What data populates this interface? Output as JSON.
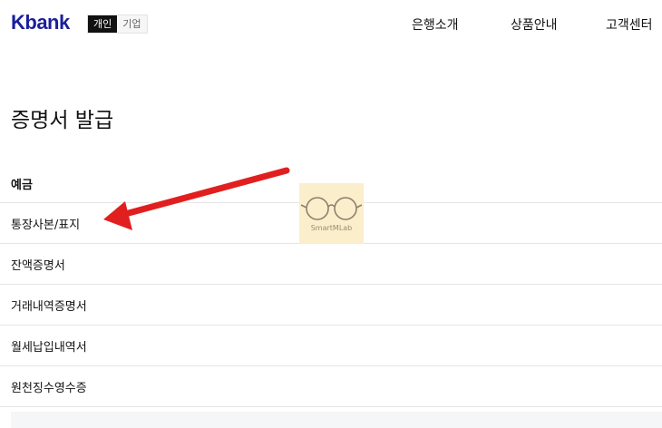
{
  "header": {
    "logo": "Kbank",
    "segments": [
      {
        "label": "개인",
        "active": true
      },
      {
        "label": "기업",
        "active": false
      }
    ],
    "nav": [
      {
        "label": "은행소개"
      },
      {
        "label": "상품안내"
      },
      {
        "label": "고객센터"
      }
    ]
  },
  "page": {
    "title": "증명서 발급"
  },
  "section": {
    "label": "예금",
    "items": [
      {
        "label": "통장사본/표지"
      },
      {
        "label": "잔액증명서"
      },
      {
        "label": "거래내역증명서"
      },
      {
        "label": "월세납입내역서"
      },
      {
        "label": "원천징수영수증"
      }
    ]
  },
  "watermark": {
    "text": "SmartMLab"
  },
  "colors": {
    "brand": "#1a1f9c",
    "arrow": "#e11f1f",
    "watermark_bg": "#fbeecb"
  }
}
